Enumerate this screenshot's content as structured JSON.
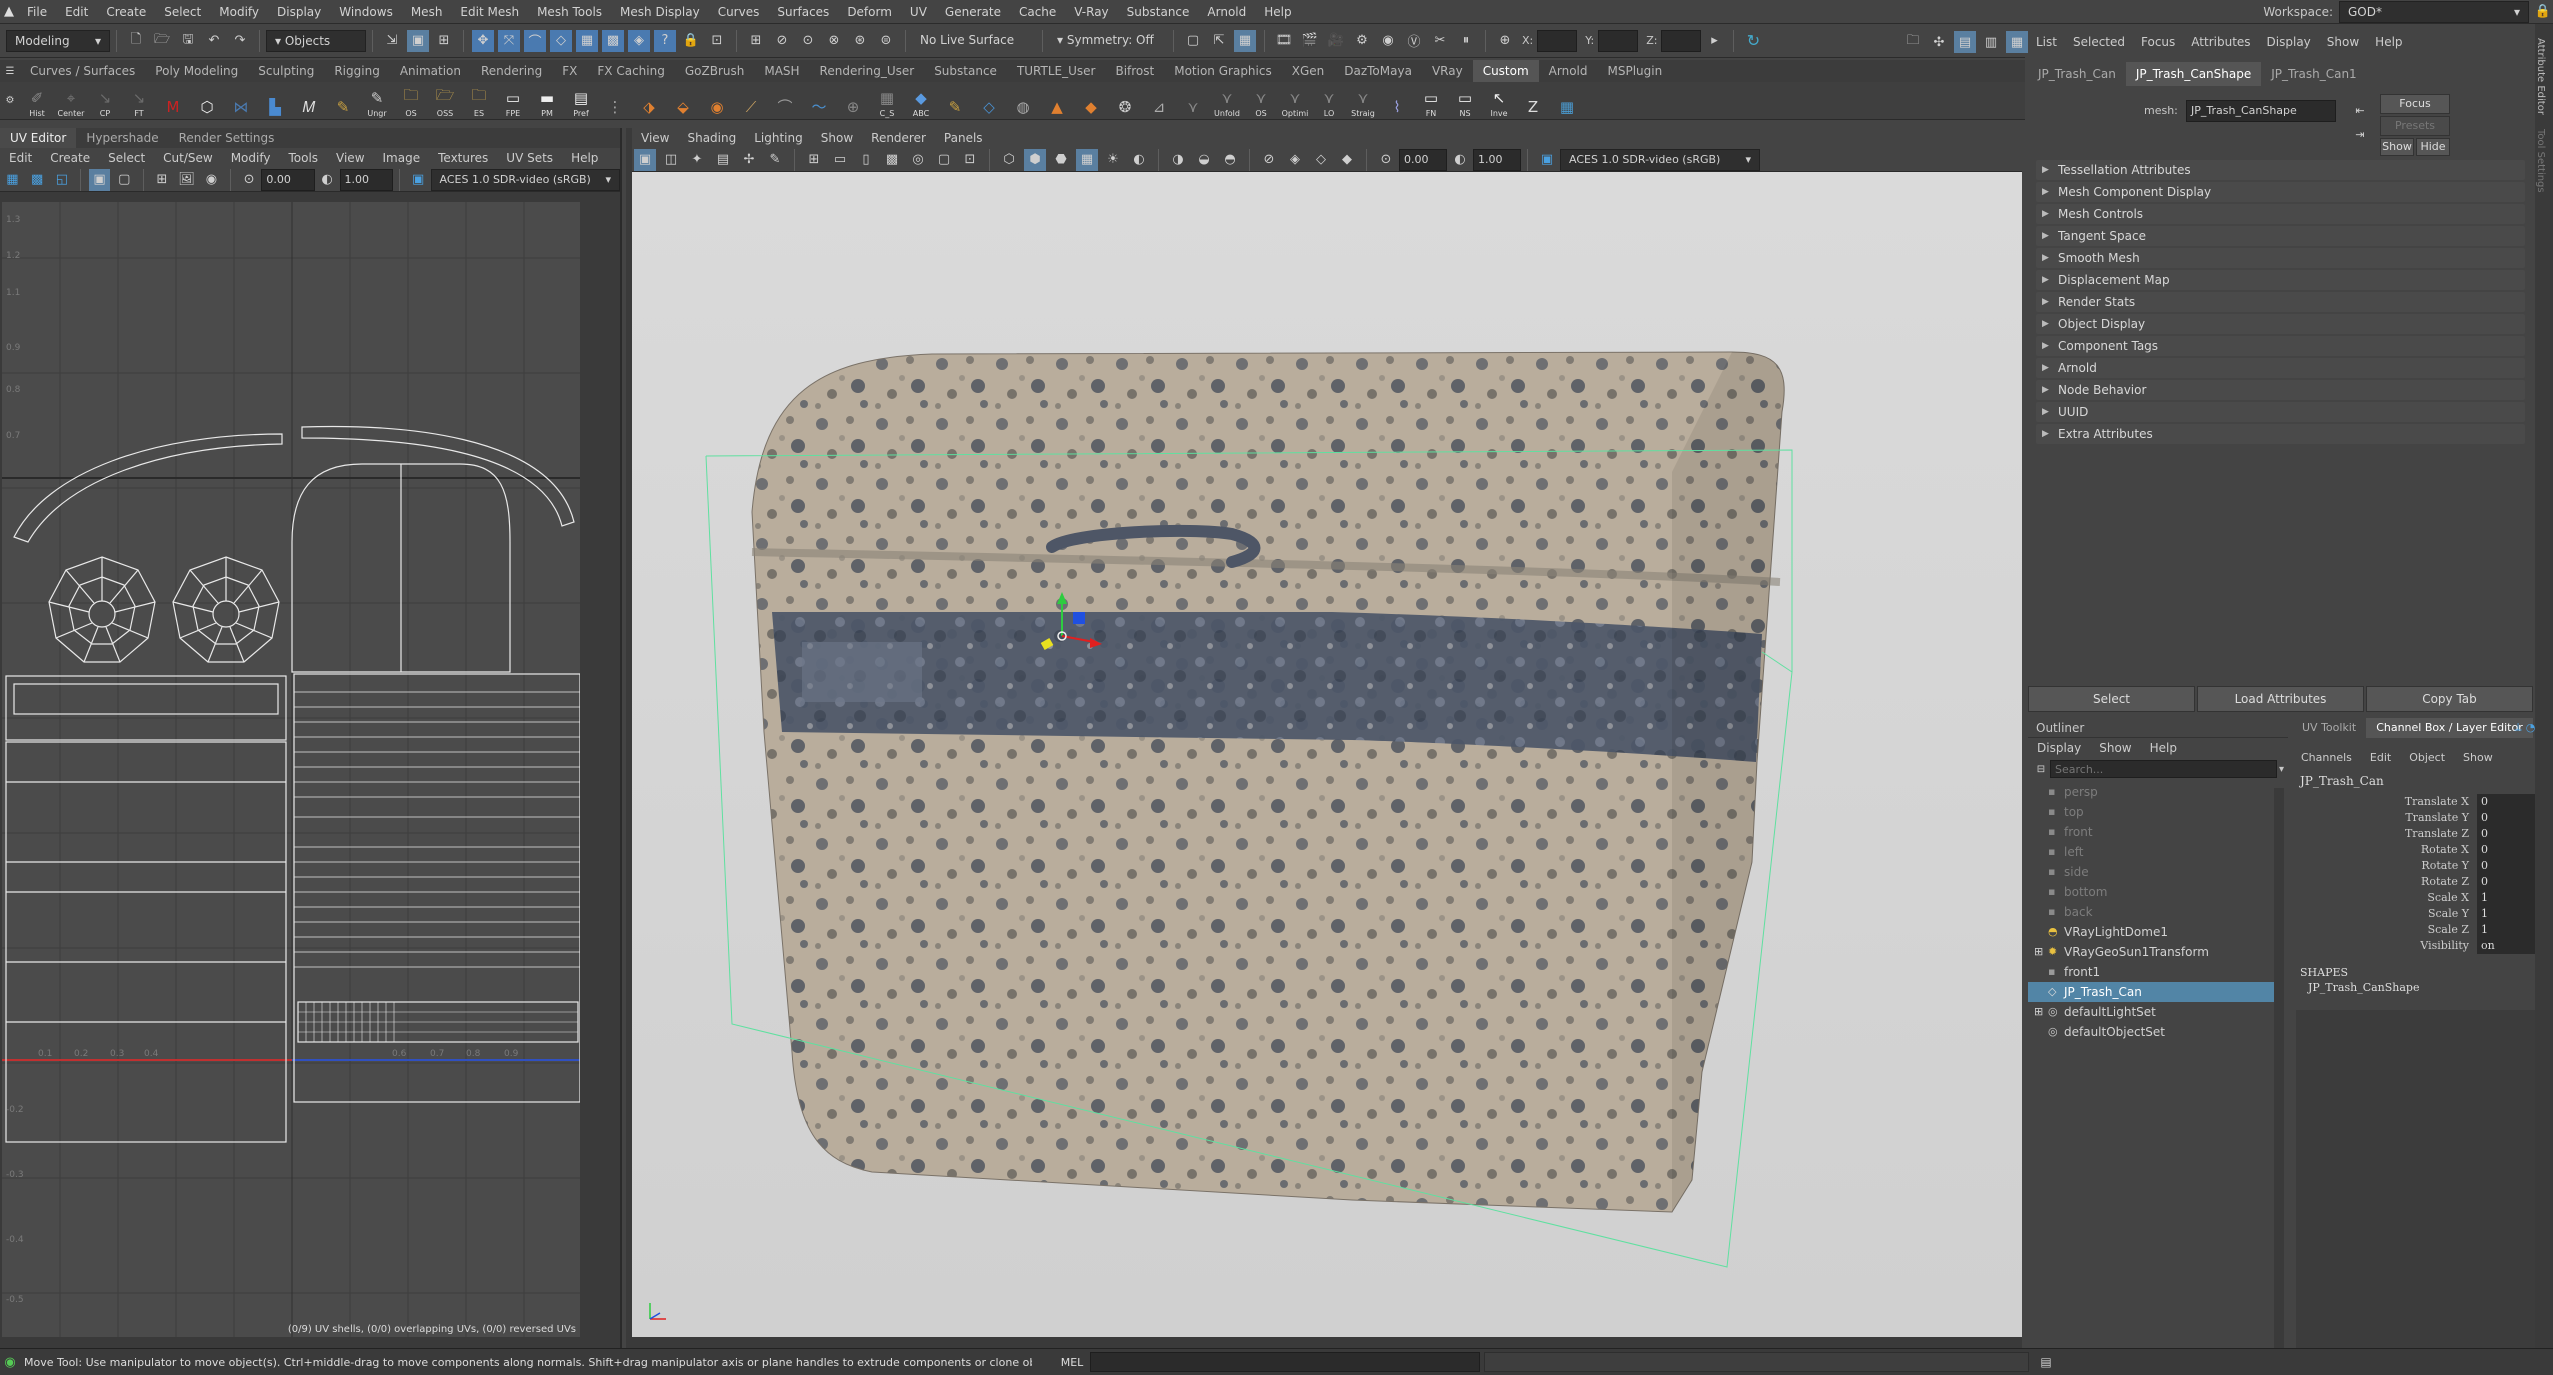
{
  "menubar": {
    "items": [
      "File",
      "Edit",
      "Create",
      "Select",
      "Modify",
      "Display",
      "Windows",
      "Mesh",
      "Edit Mesh",
      "Mesh Tools",
      "Mesh Display",
      "Curves",
      "Surfaces",
      "Deform",
      "UV",
      "Generate",
      "Cache",
      "V-Ray",
      "Substance",
      "Arnold",
      "Help"
    ],
    "workspace_label": "Workspace:",
    "workspace_value": "GOD*"
  },
  "statusline": {
    "mode": "Modeling",
    "objects": "Objects",
    "live_surface": "No Live Surface",
    "symmetry": "Symmetry: Off",
    "x_label": "X:",
    "y_label": "Y:",
    "z_label": "Z:"
  },
  "shelf_tabs": [
    "Curves / Surfaces",
    "Poly Modeling",
    "Sculpting",
    "Rigging",
    "Animation",
    "Rendering",
    "FX",
    "FX Caching",
    "GoZBrush",
    "MASH",
    "Rendering_User",
    "Substance",
    "TURTLE_User",
    "Bifrost",
    "Motion Graphics",
    "XGen",
    "DazToMaya",
    "VRay",
    "Custom",
    "Arnold",
    "MSPlugin"
  ],
  "shelf_active": "Custom",
  "shelf_icons": [
    {
      "label": "Hist",
      "icon": "history-icon",
      "color": "#8a8a8a"
    },
    {
      "label": "Center",
      "icon": "center-pivot-icon",
      "color": "#7a7a7a"
    },
    {
      "label": "CP",
      "icon": "curve-point-icon",
      "color": "#6a6a6a"
    },
    {
      "label": "FT",
      "icon": "freeze-transform-icon",
      "color": "#6a6a6a"
    },
    {
      "label": "",
      "icon": "maya-logo-icon",
      "color": "#c22"
    },
    {
      "label": "",
      "icon": "hexagon-icon",
      "color": "#eee"
    },
    {
      "label": "",
      "icon": "grid-icon",
      "color": "#4a7ab0"
    },
    {
      "label": "",
      "icon": "bar-chart-icon",
      "color": "#4a8ad0"
    },
    {
      "label": "",
      "icon": "script-m-icon",
      "color": "#ddd"
    },
    {
      "label": "",
      "icon": "paint-icon",
      "color": "#c8a040"
    },
    {
      "label": "Ungr",
      "icon": "ungroup-icon",
      "color": "#ccc"
    },
    {
      "label": "OS",
      "icon": "folder-icon",
      "color": "#d8b050"
    },
    {
      "label": "OSS",
      "icon": "folder-open-icon",
      "color": "#d8b050"
    },
    {
      "label": "ES",
      "icon": "folder-export-icon",
      "color": "#d8b050"
    },
    {
      "label": "FPE",
      "icon": "window-icon",
      "color": "#eee"
    },
    {
      "label": "PM",
      "icon": "panel-icon",
      "color": "#eee"
    },
    {
      "label": "Pref",
      "icon": "preferences-icon",
      "color": "#eee"
    },
    {
      "label": "",
      "icon": "node-icon",
      "color": "#aaa"
    },
    {
      "label": "",
      "icon": "merge-icon",
      "color": "#e08030"
    },
    {
      "label": "",
      "icon": "stack-icon",
      "color": "#e08030"
    },
    {
      "label": "",
      "icon": "sphere-icon",
      "color": "#e08030"
    },
    {
      "label": "",
      "icon": "knife-icon",
      "color": "#c8a060"
    },
    {
      "label": "",
      "icon": "bridge-icon",
      "color": "#999"
    },
    {
      "label": "",
      "icon": "wave-icon",
      "color": "#4a90d0"
    },
    {
      "label": "",
      "icon": "target-icon",
      "color": "#888"
    },
    {
      "label": "C_S",
      "icon": "cube-stack-icon",
      "color": "#888"
    },
    {
      "label": "ABC",
      "icon": "cube-blue-icon",
      "color": "#5a9ae0"
    },
    {
      "label": "",
      "icon": "brush-icon",
      "color": "#c8a040"
    },
    {
      "label": "",
      "icon": "diamond-icon",
      "color": "#4a90d0"
    },
    {
      "label": "",
      "icon": "sculpt-icon",
      "color": "#aaa"
    },
    {
      "label": "",
      "icon": "cone-icon",
      "color": "#e08030"
    },
    {
      "label": "",
      "icon": "gem-icon",
      "color": "#e08030"
    },
    {
      "label": "",
      "icon": "ball-icon",
      "color": "#ccc"
    },
    {
      "label": "",
      "icon": "measure-icon",
      "color": "#aaa"
    },
    {
      "label": "",
      "icon": "split-icon",
      "color": "#888"
    },
    {
      "label": "Unfold",
      "icon": "unfold-icon",
      "color": "#888"
    },
    {
      "label": "OS",
      "icon": "optimize-icon",
      "color": "#888"
    },
    {
      "label": "Optimi",
      "icon": "optimize2-icon",
      "color": "#888"
    },
    {
      "label": "LO",
      "icon": "layout-icon",
      "color": "#888"
    },
    {
      "label": "Straig",
      "icon": "straighten-icon",
      "color": "#888"
    },
    {
      "label": "",
      "icon": "hook-icon",
      "color": "#9aa0e0"
    },
    {
      "label": "FN",
      "icon": "face-normal-icon",
      "color": "#eee"
    },
    {
      "label": "NS",
      "icon": "normal-size-icon",
      "color": "#eee"
    },
    {
      "label": "Inve",
      "icon": "invert-icon",
      "color": "#eee"
    },
    {
      "label": "",
      "icon": "goz-icon",
      "color": "#ddd"
    },
    {
      "label": "",
      "icon": "mosaic-icon",
      "color": "#4a9ad0"
    }
  ],
  "uv_editor": {
    "tabs": [
      "UV Editor",
      "Hypershade",
      "Render Settings"
    ],
    "menu": [
      "Edit",
      "Create",
      "Select",
      "Cut/Sew",
      "Modify",
      "Tools",
      "View",
      "Image",
      "Textures",
      "UV Sets",
      "Help"
    ],
    "exposure": "0.00",
    "gamma": "1.00",
    "colorspace": "ACES 1.0 SDR-video (sRGB)",
    "status": "(0/9) UV shells, (0/0) overlapping UVs, (0/0) reversed UVs",
    "v_ticks": [
      "1.3",
      "1.2",
      "1.1",
      "0.9",
      "0.8",
      "0.7",
      "-0.2",
      "-0.3",
      "-0.4",
      "-0.5"
    ],
    "u_ticks": [
      "0.1",
      "0.2",
      "0.3",
      "0.4",
      "0.6",
      "0.7",
      "0.8",
      "0.9"
    ]
  },
  "viewport": {
    "menu": [
      "View",
      "Shading",
      "Lighting",
      "Show",
      "Renderer",
      "Panels"
    ],
    "exposure": "0.00",
    "gamma": "1.00",
    "colorspace": "ACES 1.0 SDR-video (sRGB)"
  },
  "attr_editor": {
    "menu": [
      "List",
      "Selected",
      "Focus",
      "Attributes",
      "Display",
      "Show",
      "Help"
    ],
    "tabs": [
      "JP_Trash_Can",
      "JP_Trash_CanShape",
      "JP_Trash_Can1"
    ],
    "mesh_label": "mesh:",
    "mesh_value": "JP_Trash_CanShape",
    "focus": "Focus",
    "presets": "Presets",
    "show": "Show",
    "hide": "Hide",
    "sections": [
      "Tessellation Attributes",
      "Mesh Component Display",
      "Mesh Controls",
      "Tangent Space",
      "Smooth Mesh",
      "Displacement Map",
      "Render Stats",
      "Object Display",
      "Component Tags",
      "Arnold",
      "Node Behavior",
      "UUID",
      "Extra Attributes"
    ],
    "select": "Select",
    "load": "Load Attributes",
    "copy": "Copy Tab",
    "vertical_tabs": [
      "Attribute Editor",
      "Tool Settings"
    ]
  },
  "outliner": {
    "title": "Outliner",
    "menu": [
      "Display",
      "Show",
      "Help"
    ],
    "search_placeholder": "Search...",
    "items": [
      {
        "label": "persp",
        "dim": true,
        "icon": "camera-icon"
      },
      {
        "label": "top",
        "dim": true,
        "icon": "camera-icon"
      },
      {
        "label": "front",
        "dim": true,
        "icon": "camera-icon"
      },
      {
        "label": "left",
        "dim": true,
        "icon": "camera-icon"
      },
      {
        "label": "side",
        "dim": true,
        "icon": "camera-icon"
      },
      {
        "label": "bottom",
        "dim": true,
        "icon": "camera-icon"
      },
      {
        "label": "back",
        "dim": true,
        "icon": "camera-icon"
      },
      {
        "label": "VRayLightDome1",
        "dim": false,
        "icon": "dome-light-icon"
      },
      {
        "label": "VRayGeoSun1Transform",
        "dim": false,
        "icon": "sun-icon",
        "expand": true
      },
      {
        "label": "front1",
        "dim": false,
        "icon": "camera-icon"
      },
      {
        "label": "JP_Trash_Can",
        "dim": false,
        "icon": "mesh-icon",
        "selected": true
      },
      {
        "label": "defaultLightSet",
        "dim": false,
        "icon": "set-icon",
        "expand": true
      },
      {
        "label": "defaultObjectSet",
        "dim": false,
        "icon": "set-icon"
      }
    ]
  },
  "channel_box": {
    "tabs": [
      "UV Toolkit",
      "Channel Box / Layer Editor"
    ],
    "menu": [
      "Channels",
      "Edit",
      "Object",
      "Show"
    ],
    "object": "JP_Trash_Can",
    "channels": [
      {
        "name": "Translate X",
        "value": "0"
      },
      {
        "name": "Translate Y",
        "value": "0"
      },
      {
        "name": "Translate Z",
        "value": "0"
      },
      {
        "name": "Rotate X",
        "value": "0"
      },
      {
        "name": "Rotate Y",
        "value": "0"
      },
      {
        "name": "Rotate Z",
        "value": "0"
      },
      {
        "name": "Scale X",
        "value": "1"
      },
      {
        "name": "Scale Y",
        "value": "1"
      },
      {
        "name": "Scale Z",
        "value": "1"
      },
      {
        "name": "Visibility",
        "value": "on"
      }
    ],
    "shapes_label": "SHAPES",
    "shape": "JP_Trash_CanShape"
  },
  "helpline": {
    "text": "Move Tool: Use manipulator to move object(s). Ctrl+middle-drag to move components along normals. Shift+drag manipulator axis or plane handles to extrude components or clone objects. Ctrl+Shift+drag to constrain movement to connected edges. Use D or INSERT to change the pivot position and axis orientation.",
    "mel": "MEL"
  },
  "colors": {
    "selection": "#5285a6",
    "bounding_box": "#5fe0a0",
    "uv_wire": "#e8e8e8",
    "uv_u_axis": "#c03030",
    "uv_v_axis": "#3050c0"
  }
}
